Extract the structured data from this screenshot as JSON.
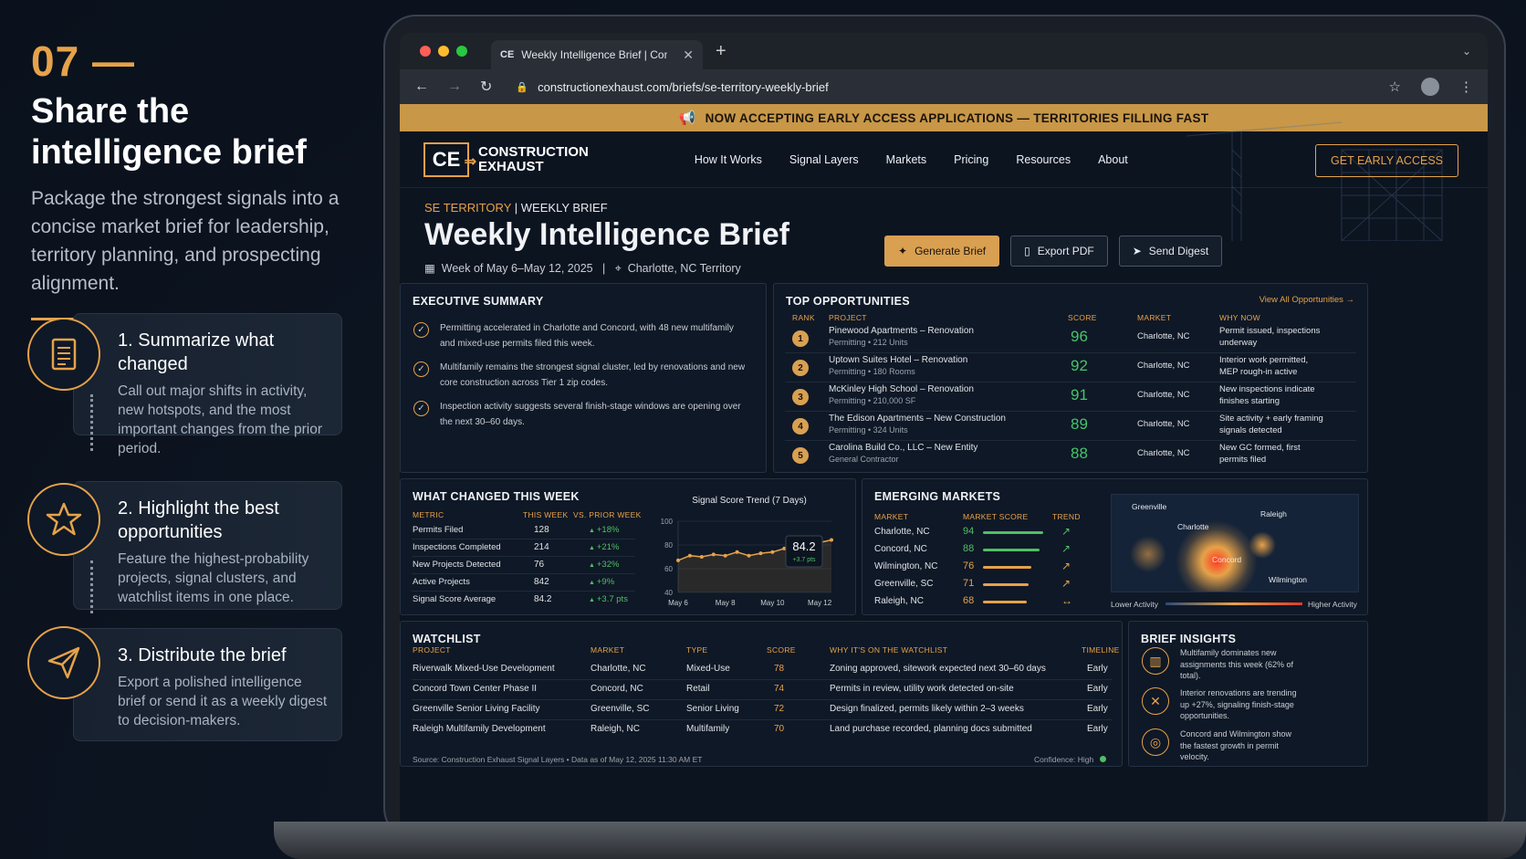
{
  "left": {
    "step_number": "07",
    "step_dash": "—",
    "title": "Share the intelligence brief",
    "description": "Package the strongest signals into a concise market brief for leadership, territory planning, and prospecting alignment.",
    "steps": [
      {
        "title": "1. Summarize what changed",
        "text": "Call out major shifts in activity, new hotspots, and the most important changes from the prior period.",
        "icon": "document-icon"
      },
      {
        "title": "2. Highlight the best opportunities",
        "text": "Feature the highest-probability projects, signal clusters, and watchlist items in one place.",
        "icon": "star-icon"
      },
      {
        "title": "3. Distribute the brief",
        "text": "Export a polished intelligence brief or send it as a weekly digest to decision-makers.",
        "icon": "send-icon"
      }
    ]
  },
  "browser": {
    "tab_favicon": "CE",
    "tab_title": "Weekly Intelligence Brief | Constr",
    "url": "constructionexhaust.com/briefs/se-territory-weekly-brief"
  },
  "site": {
    "banner": "NOW ACCEPTING EARLY ACCESS APPLICATIONS — TERRITORIES FILLING FAST",
    "logo_mark": "CE",
    "logo_line1": "CONSTRUCTION",
    "logo_line2": "EXHAUST",
    "nav": [
      "How It Works",
      "Signal Layers",
      "Markets",
      "Pricing",
      "Resources",
      "About"
    ],
    "cta": "GET EARLY ACCESS"
  },
  "hero": {
    "crumb_a": "SE TERRITORY",
    "crumb_sep": "|",
    "crumb_b": "WEEKLY BRIEF",
    "title": "Weekly Intelligence Brief",
    "week": "Week of May 6–May 12, 2025",
    "meta_sep": "|",
    "location": "Charlotte, NC Territory",
    "buttons": [
      "Generate Brief",
      "Export PDF",
      "Send Digest"
    ]
  },
  "summary": {
    "title": "EXECUTIVE SUMMARY",
    "items": [
      "Permitting accelerated in Charlotte and Concord, with 48 new multifamily and mixed-use permits filed this week.",
      "Multifamily remains the strongest signal cluster, led by renovations and new core construction across Tier 1 zip codes.",
      "Inspection activity suggests several finish-stage windows are opening over the next 30–60 days."
    ]
  },
  "opps": {
    "title": "TOP OPPORTUNITIES",
    "view_all": "View All Opportunities →",
    "headers": [
      "RANK",
      "PROJECT",
      "SCORE",
      "MARKET",
      "WHY NOW"
    ],
    "rows": [
      {
        "rank": "1",
        "project": "Pinewood Apartments – Renovation",
        "sub": "Permitting • 212 Units",
        "score": "96",
        "market": "Charlotte, NC",
        "why1": "Permit issued, inspections",
        "why2": "underway"
      },
      {
        "rank": "2",
        "project": "Uptown Suites Hotel – Renovation",
        "sub": "Permitting • 180 Rooms",
        "score": "92",
        "market": "Charlotte, NC",
        "why1": "Interior work permitted,",
        "why2": "MEP rough-in active"
      },
      {
        "rank": "3",
        "project": "McKinley High School – Renovation",
        "sub": "Permitting • 210,000 SF",
        "score": "91",
        "market": "Charlotte, NC",
        "why1": "New inspections indicate",
        "why2": "finishes starting"
      },
      {
        "rank": "4",
        "project": "The Edison Apartments – New Construction",
        "sub": "Permitting • 324 Units",
        "score": "89",
        "market": "Charlotte, NC",
        "why1": "Site activity + early framing",
        "why2": "signals detected"
      },
      {
        "rank": "5",
        "project": "Carolina Build Co., LLC – New Entity",
        "sub": "General Contractor",
        "score": "88",
        "market": "Charlotte, NC",
        "why1": "New GC formed, first",
        "why2": "permits filed"
      }
    ]
  },
  "changed": {
    "title": "WHAT CHANGED THIS WEEK",
    "headers": [
      "METRIC",
      "THIS WEEK",
      "VS. PRIOR WEEK"
    ],
    "rows": [
      {
        "metric": "Permits Filed",
        "value": "128",
        "delta": "+18%"
      },
      {
        "metric": "Inspections Completed",
        "value": "214",
        "delta": "+21%"
      },
      {
        "metric": "New Projects Detected",
        "value": "76",
        "delta": "+32%"
      },
      {
        "metric": "Active Projects",
        "value": "842",
        "delta": "+9%"
      },
      {
        "metric": "Signal Score Average",
        "value": "84.2",
        "delta": "+3.7 pts"
      }
    ]
  },
  "chart_data": {
    "type": "line",
    "title": "Signal Score Trend (7 Days)",
    "x_ticks": [
      "May 6",
      "May 8",
      "May 10",
      "May 12"
    ],
    "x": [
      0,
      0.5,
      1,
      1.5,
      2,
      2.5,
      3,
      3.5,
      4,
      4.5,
      5,
      5.5,
      6,
      6.5
    ],
    "values": [
      67,
      71,
      70,
      72,
      71,
      74,
      71,
      73,
      74,
      77,
      76,
      78,
      82,
      84.2
    ],
    "ylim": [
      40,
      100
    ],
    "y_ticks": [
      "100",
      "80",
      "60",
      "40"
    ],
    "callout_value": "84.2",
    "callout_delta": "+3.7 pts",
    "line_color": "#e6a24a"
  },
  "emerging": {
    "title": "EMERGING MARKETS",
    "headers": [
      "MARKET",
      "MARKET SCORE",
      "TREND"
    ],
    "rows": [
      {
        "market": "Charlotte, NC",
        "score": "94",
        "level": 0.94,
        "color": "#4fbf65",
        "trend": "↗"
      },
      {
        "market": "Concord, NC",
        "score": "88",
        "level": 0.88,
        "color": "#4fbf65",
        "trend": "↗"
      },
      {
        "market": "Wilmington, NC",
        "score": "76",
        "level": 0.76,
        "color": "#e6a24a",
        "trend": "↗"
      },
      {
        "market": "Greenville, SC",
        "score": "71",
        "level": 0.71,
        "color": "#e6a24a",
        "trend": "↗"
      },
      {
        "market": "Raleigh, NC",
        "score": "68",
        "level": 0.68,
        "color": "#e6a24a",
        "trend": "↔"
      }
    ],
    "map_labels": [
      "Greenville",
      "Charlotte",
      "Raleigh",
      "Concord",
      "Wilmington"
    ],
    "legend_low": "Lower Activity",
    "legend_high": "Higher Activity"
  },
  "watchlist": {
    "title": "WATCHLIST",
    "headers": [
      "PROJECT",
      "MARKET",
      "TYPE",
      "SCORE",
      "WHY IT'S ON THE WATCHLIST",
      "TIMELINE"
    ],
    "rows": [
      {
        "project": "Riverwalk Mixed-Use Development",
        "market": "Charlotte, NC",
        "type": "Mixed-Use",
        "score": "78",
        "why": "Zoning approved, sitework expected next 30–60 days",
        "timeline": "Early"
      },
      {
        "project": "Concord Town Center Phase II",
        "market": "Concord, NC",
        "type": "Retail",
        "score": "74",
        "why": "Permits in review, utility work detected on-site",
        "timeline": "Early"
      },
      {
        "project": "Greenville Senior Living Facility",
        "market": "Greenville, SC",
        "type": "Senior Living",
        "score": "72",
        "why": "Design finalized, permits likely within 2–3 weeks",
        "timeline": "Early"
      },
      {
        "project": "Raleigh Multifamily Development",
        "market": "Raleigh, NC",
        "type": "Multifamily",
        "score": "70",
        "why": "Land purchase recorded, planning docs submitted",
        "timeline": "Early"
      }
    ],
    "source": "Source: Construction Exhaust Signal Layers   •   Data as of May 12, 2025 11:30 AM ET",
    "confidence": "Confidence: High"
  },
  "insights": {
    "title": "BRIEF INSIGHTS",
    "items": [
      {
        "icon": "building-icon",
        "text": "Multifamily dominates new assignments this week (62% of total)."
      },
      {
        "icon": "tools-icon",
        "text": "Interior renovations are trending up +27%, signaling finish-stage opportunities."
      },
      {
        "icon": "target-icon",
        "text": "Concord and Wilmington show the fastest growth in permit velocity."
      }
    ]
  }
}
